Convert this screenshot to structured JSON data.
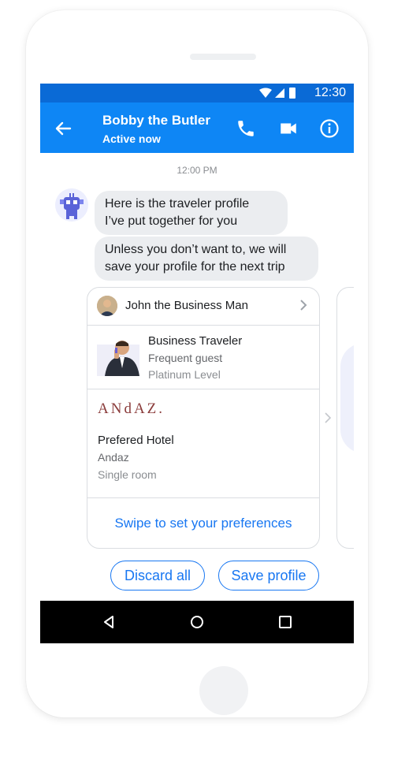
{
  "status_bar": {
    "time": "12:30"
  },
  "header": {
    "title": "Bobby the Butler",
    "subtitle": "Active now"
  },
  "conversation": {
    "timestamp": "12:00 PM",
    "messages": [
      {
        "text": "Here is the traveler profile\nI’ve put together for you"
      },
      {
        "text": "Unless you don’t want to, we will\nsave your profile for the next trip"
      }
    ]
  },
  "card": {
    "profile_name": "John the Business Man",
    "traveler": {
      "type": "Business Traveler",
      "status": "Frequent guest",
      "level": "Platinum Level"
    },
    "hotel": {
      "logo": "ANdAZ.",
      "label": "Prefered Hotel",
      "name": "Andaz",
      "room": "Single room"
    },
    "cta": "Swipe to set your preferences"
  },
  "quick_replies": {
    "discard": "Discard all",
    "save": "Save profile"
  },
  "colors": {
    "status_bar": "#0a6ad6",
    "app_bar": "#0e86f5",
    "accent": "#1877f2",
    "bubble": "#ebedf0"
  }
}
